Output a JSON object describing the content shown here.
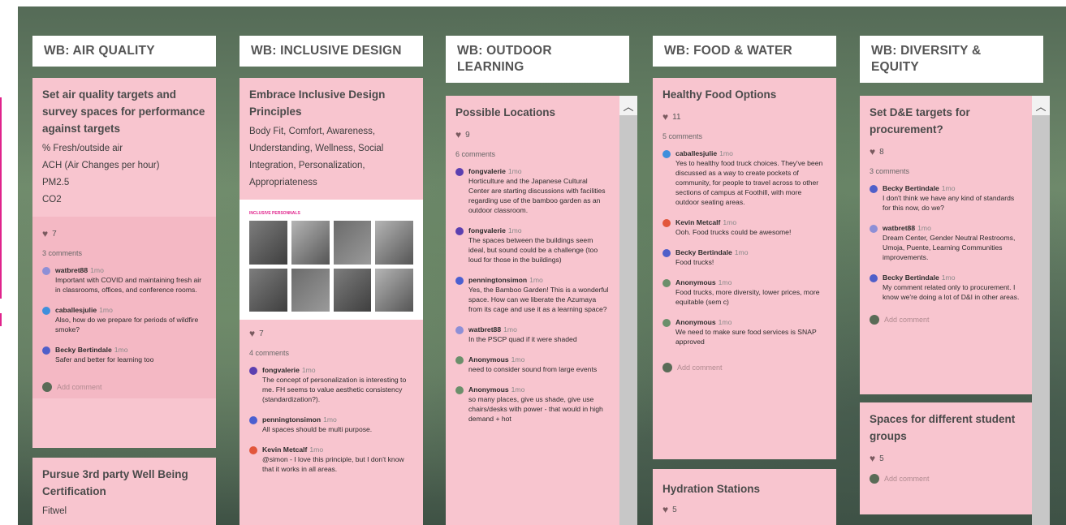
{
  "columns": [
    {
      "header": "WB: AIR QUALITY",
      "posts": [
        {
          "title": "Set air quality targets and survey spaces for performance against targets",
          "lines": [
            "% Fresh/outside air",
            "ACH (Air Changes per hour)",
            "PM2.5",
            "CO2"
          ],
          "likes": "7",
          "comments_label": "3 comments",
          "comments": [
            {
              "author": "watbret88",
              "time": "1mo",
              "text": "Important with COVID and maintaining fresh air in classrooms, offices, and conference rooms.",
              "color": "#8d8fd6"
            },
            {
              "author": "caballesjulie",
              "time": "1mo",
              "text": "Also, how do we prepare for periods of wildfire smoke?",
              "color": "#3f8fdc"
            },
            {
              "author": "Becky Bertindale",
              "time": "1mo",
              "text": "Safer and better for learning too",
              "color": "#4f5fc9"
            }
          ],
          "add_comment": "Add comment"
        },
        {
          "title": "Pursue 3rd party Well Being Certification",
          "lines": [
            "Fitwel"
          ]
        }
      ]
    },
    {
      "header": "WB: INCLUSIVE DESIGN",
      "posts": [
        {
          "title": "Embrace Inclusive Design Principles",
          "lines": [
            "Body Fit, Comfort, Awareness, Understanding, Wellness, Social Integration, Personalization, Appropriateness"
          ],
          "image_caption": "INCLUSIVE PERSONNALS",
          "likes": "7",
          "comments_label": "4 comments",
          "comments": [
            {
              "author": "fongvalerie",
              "time": "1mo",
              "text": "The concept of personalization is interesting to me. FH seems to value aesthetic consistency (standardization?).",
              "color": "#5b3fb0"
            },
            {
              "author": "penningtonsimon",
              "time": "1mo",
              "text": "All spaces should be multi purpose.",
              "color": "#4b5fd0"
            },
            {
              "author": "Kevin Metcalf",
              "time": "1mo",
              "text": "@simon - I love this principle, but I don't know that it works in all areas.",
              "color": "#e2563b"
            }
          ]
        }
      ]
    },
    {
      "header": "WB: OUTDOOR LEARNING",
      "posts": [
        {
          "title": "Possible Locations",
          "likes": "9",
          "comments_label": "6 comments",
          "comments": [
            {
              "author": "fongvalerie",
              "time": "1mo",
              "text": "Horticulture and the Japanese Cultural Center are starting discussions with facilities regarding use of the bamboo garden as an outdoor classroom.",
              "color": "#5b3fb0"
            },
            {
              "author": "fongvalerie",
              "time": "1mo",
              "text": "The spaces between the buildings seem ideal, but sound could be a challenge (too loud for those in the buildings)",
              "color": "#5b3fb0"
            },
            {
              "author": "penningtonsimon",
              "time": "1mo",
              "text": "Yes, the Bamboo Garden! This is a wonderful space. How can we liberate the Azumaya from its cage and use it as a learning space?",
              "color": "#4b5fd0"
            },
            {
              "author": "watbret88",
              "time": "1mo",
              "text": "In the PSCP quad if it were shaded",
              "color": "#8d8fd6"
            },
            {
              "author": "Anonymous",
              "time": "1mo",
              "text": "need to consider sound from large events",
              "color": "#6b8f6b"
            },
            {
              "author": "Anonymous",
              "time": "1mo",
              "text": "so many places, give us shade, give use chairs/desks with power - that would in high demand + hot",
              "color": "#6b8f6b"
            }
          ]
        }
      ]
    },
    {
      "header": "WB: FOOD & WATER",
      "posts": [
        {
          "title": "Healthy Food Options",
          "likes": "11",
          "comments_label": "5 comments",
          "comments": [
            {
              "author": "caballesjulie",
              "time": "1mo",
              "text": "Yes to healthy food truck choices. They've been discussed as a way to create pockets of community, for people to travel across to other sections of campus at Foothill, with more outdoor seating areas.",
              "color": "#3f8fdc"
            },
            {
              "author": "Kevin Metcalf",
              "time": "1mo",
              "text": "Ooh. Food trucks could be awesome!",
              "color": "#e2563b"
            },
            {
              "author": "Becky Bertindale",
              "time": "1mo",
              "text": "Food trucks!",
              "color": "#4f5fc9"
            },
            {
              "author": "Anonymous",
              "time": "1mo",
              "text": "Food trucks, more diversity, lower prices, more equitable (sem c)",
              "color": "#6b8f6b"
            },
            {
              "author": "Anonymous",
              "time": "1mo",
              "text": "We need to make sure food services is SNAP approved",
              "color": "#6b8f6b"
            }
          ],
          "add_comment": "Add comment"
        },
        {
          "title": "Hydration Stations",
          "likes": "5"
        }
      ]
    },
    {
      "header": "WB: DIVERSITY & EQUITY",
      "posts": [
        {
          "title": "Set D&E targets for procurement?",
          "likes": "8",
          "comments_label": "3 comments",
          "comments": [
            {
              "author": "Becky Bertindale",
              "time": "1mo",
              "text": "I don't think we have any kind of standards for this now, do we?",
              "color": "#4f5fc9"
            },
            {
              "author": "watbret88",
              "time": "1mo",
              "text": "Dream Center, Gender Neutral Restrooms, Umoja, Puente, Learning Communities improvements.",
              "color": "#8d8fd6"
            },
            {
              "author": "Becky Bertindale",
              "time": "1mo",
              "text": "My comment related only to procurement. I know we're doing a lot of D&I in other areas.",
              "color": "#4f5fc9"
            }
          ],
          "add_comment": "Add comment"
        },
        {
          "title": "Spaces for different student groups",
          "likes": "5",
          "add_comment": "Add comment"
        }
      ]
    }
  ],
  "icons": {
    "heart": "heart-icon",
    "scroll_up": "chevron-up-icon"
  },
  "colors": {
    "post_bg": "#f8c5cf",
    "edge_mark": "#e0238c"
  }
}
